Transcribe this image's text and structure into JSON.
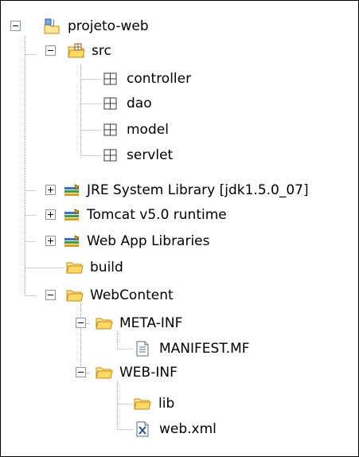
{
  "colors": {
    "background": "#ffffff",
    "border": "#000000",
    "connector_line": "#a0a0a0",
    "toggle_border": "#7f9db9",
    "folder_fill": "#ffe79a",
    "folder_outline": "#c58a10",
    "library_books": [
      "#3a6fc4",
      "#3e9a3e",
      "#d9a21b"
    ]
  },
  "tree": [
    {
      "label": "projeto-web",
      "icon": "project-icon",
      "toggle": "expanded"
    },
    {
      "label": "src",
      "icon": "source-folder-icon",
      "toggle": "expanded"
    },
    {
      "label": "controller",
      "icon": "package-icon",
      "toggle": null
    },
    {
      "label": "dao",
      "icon": "package-icon",
      "toggle": null
    },
    {
      "label": "model",
      "icon": "package-icon",
      "toggle": null
    },
    {
      "label": "servlet",
      "icon": "package-icon",
      "toggle": null
    },
    {
      "label": "JRE System Library [jdk1.5.0_07]",
      "icon": "library-icon",
      "toggle": "collapsed"
    },
    {
      "label": "Tomcat v5.0 runtime",
      "icon": "library-icon",
      "toggle": "collapsed"
    },
    {
      "label": "Web App Libraries",
      "icon": "library-icon",
      "toggle": "collapsed"
    },
    {
      "label": "build",
      "icon": "folder-icon",
      "toggle": null
    },
    {
      "label": "WebContent",
      "icon": "folder-icon",
      "toggle": "expanded"
    },
    {
      "label": "META-INF",
      "icon": "folder-icon",
      "toggle": "expanded"
    },
    {
      "label": "MANIFEST.MF",
      "icon": "text-file-icon",
      "toggle": null
    },
    {
      "label": "WEB-INF",
      "icon": "folder-icon",
      "toggle": "expanded"
    },
    {
      "label": "lib",
      "icon": "folder-icon",
      "toggle": null
    },
    {
      "label": "web.xml",
      "icon": "xml-file-icon",
      "toggle": null
    }
  ]
}
